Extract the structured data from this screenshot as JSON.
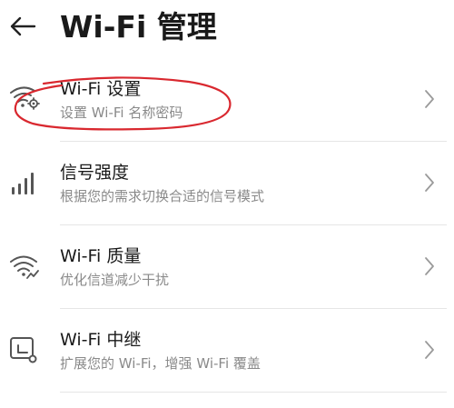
{
  "header": {
    "back_icon": "arrow-left-icon",
    "title": "Wi-Fi 管理"
  },
  "items": [
    {
      "title": "Wi-Fi 设置",
      "subtitle": "设置 Wi-Fi 名称密码",
      "icon": "wifi-settings-icon",
      "highlighted": true
    },
    {
      "title": "信号强度",
      "subtitle": "根据您的需求切换合适的信号模式",
      "icon": "signal-strength-icon"
    },
    {
      "title": "Wi-Fi 质量",
      "subtitle": "优化信道减少干扰",
      "icon": "wifi-quality-icon"
    },
    {
      "title": "Wi-Fi 中继",
      "subtitle": "扩展您的 Wi-Fi，增强 Wi-Fi 覆盖",
      "icon": "wifi-relay-icon"
    }
  ],
  "colors": {
    "text": "#1a1a1a",
    "subtext": "#8a8a8a",
    "icon": "#555555",
    "highlight": "#d9282f"
  }
}
